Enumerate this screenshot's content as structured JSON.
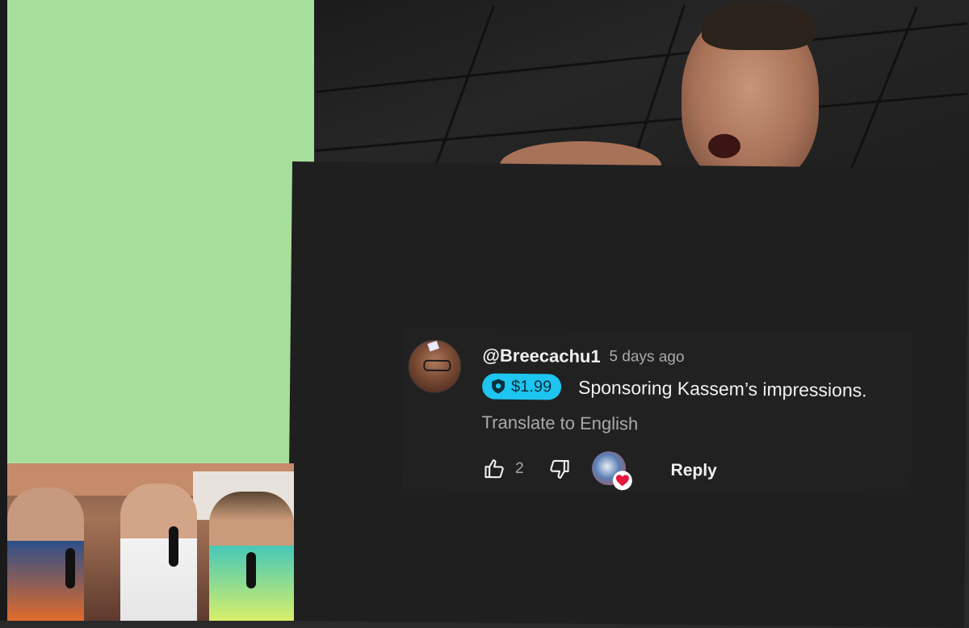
{
  "comment": {
    "username": "@Breecachu1",
    "timestamp": "5 days ago",
    "super_thanks": {
      "amount": "$1.99",
      "color": "#1ec5f0"
    },
    "text": "Sponsoring Kassem’s impressions.",
    "translate_label": "Translate to English",
    "like_count": "2",
    "reply_label": "Reply",
    "creator_heart": true
  },
  "colors": {
    "green_panel": "#a7de9b",
    "comment_background": "#212121",
    "heart": "#e5173f"
  }
}
